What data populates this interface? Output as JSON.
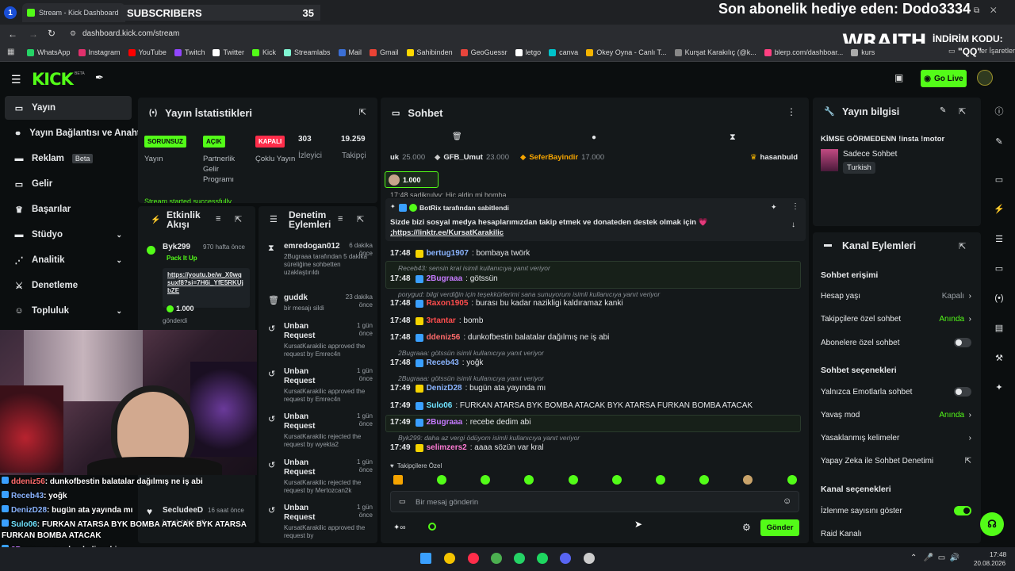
{
  "browser": {
    "tab_title": "Stream - Kick Dashboard",
    "url": "dashboard.kick.com/stream",
    "bookmarks": [
      "WhatsApp",
      "Instagram",
      "YouTube",
      "Twitch",
      "Twitter",
      "Kick",
      "Streamlabs",
      "Mail",
      "Gmail",
      "Sahibinden",
      "GeoGuessr",
      "letgo",
      "canva",
      "Okey Oyna - Canlı T...",
      "Kurşat Karakılıç (@k...",
      "blerp.com/dashboar...",
      "kurs"
    ],
    "other_bookmarks": "ler İşaretleri"
  },
  "overlay": {
    "subscribers_label": "SUBSCRIBERS",
    "subscribers_count": "35",
    "gift_text": "Son abonelik hediye eden: Dodo3334",
    "sponsor": "WRAITH.",
    "discount_label": "İNDİRİM KODU:",
    "discount_code": "\"QQ\"",
    "chat": [
      {
        "user": "ddeniz56",
        "text": ": dunkofbestin balatalar dağılmış ne iş abi",
        "color": "#ff6b6b"
      },
      {
        "user": "Receb43",
        "text": ": yoğk",
        "color": "#8ab4ff"
      },
      {
        "user": "DenizD28",
        "text": ": bugün ata yayında mı",
        "color": "#8ab4ff"
      },
      {
        "user": "Sulo06",
        "text": ": FURKAN ATARSA BYK BOMBA ATACAK BYK ATARSA",
        "color": "#6fe3ff"
      },
      {
        "user": "",
        "text": "FURKAN BOMBA ATACAK",
        "color": "#ffffff"
      },
      {
        "user": "2Bugraaa",
        "text": ": recebe dedim abi",
        "color": "#c67bff"
      },
      {
        "user": "selimzers2",
        "text": ": aaaa sözün var kral",
        "color": "#ff7bd5"
      }
    ]
  },
  "kick": {
    "logo": "KICK",
    "beta": "BETA",
    "go_live": "Go Live"
  },
  "sidebar": {
    "items": [
      {
        "label": "Yayın",
        "icon": "video-icon"
      },
      {
        "label": "Yayın Bağlantısı ve Anahtar",
        "icon": "link-icon"
      },
      {
        "label": "Reklam",
        "icon": "ad-icon",
        "badge": "Beta"
      },
      {
        "label": "Gelir",
        "icon": "wallet-icon"
      },
      {
        "label": "Başarılar",
        "icon": "trophy-icon"
      },
      {
        "label": "Stüdyo",
        "icon": "studio-icon"
      },
      {
        "label": "Analitik",
        "icon": "chart-icon"
      },
      {
        "label": "Denetleme",
        "icon": "sword-icon"
      },
      {
        "label": "Topluluk",
        "icon": "community-icon"
      }
    ]
  },
  "stats": {
    "title": "Yayın İstatistikleri",
    "tags": [
      {
        "tag": "SORUNSUZ",
        "label": "Yayın",
        "bg": "#53fc18"
      },
      {
        "tag": "AÇIK",
        "label": "Partnerlik Gelir Programı",
        "bg": "#53fc18"
      },
      {
        "tag": "KAPALI",
        "label": "Çoklu Yayın",
        "bg": "#ff2d4a"
      }
    ],
    "viewers": "303",
    "viewers_label": "İzleyici",
    "followers": "19.259",
    "followers_label": "Takipçi",
    "banner": "Stream started successfully"
  },
  "activity": {
    "title": "Etkinlik Akışı",
    "user": "Byk299",
    "time": "970 hafta önce",
    "event": "Pack It Up",
    "link": "https://youtu.be/w_X0wqsuxf8?si=7H6i_YfE5RKUjbZE",
    "amount": "1.000",
    "sent": "gönderdi",
    "follow_user": "SecludeeD",
    "follow_time": "16 saat önce",
    "follow_text": "kanalı takip etti"
  },
  "modlog": {
    "title": "Denetim Eylemleri",
    "items": [
      {
        "user": "emredogan012",
        "time": "6 dakika önce",
        "desc": "2Bugraaa tarafından 5 dakika süreliğine sohbetten uzaklaştırıldı"
      },
      {
        "user": "guddk",
        "time": "23 dakika önce",
        "desc": "bir mesajı sildi"
      },
      {
        "user": "Unban Request",
        "time": "1 gün önce",
        "desc": "KursatKarakilic approved the request by Emrec4n"
      },
      {
        "user": "Unban Request",
        "time": "1 gün önce",
        "desc": "KursatKarakilic approved the request by Emrec4n"
      },
      {
        "user": "Unban Request",
        "time": "1 gün önce",
        "desc": "KursatKarakilic rejected the request by wyekta2"
      },
      {
        "user": "Unban Request",
        "time": "1 gün önce",
        "desc": "KursatKarakilic rejected the request by Mertozcan2k"
      },
      {
        "user": "Unban Request",
        "time": "1 gün önce",
        "desc": "KursatKarakilic approved the request by"
      }
    ]
  },
  "chat": {
    "title": "Sohbet",
    "leaderboard": [
      {
        "name": "uk",
        "amount": "25.000"
      },
      {
        "name": "GFB_Umut",
        "amount": "23.000"
      },
      {
        "name": "SeferBayindir",
        "amount": "17.000"
      },
      {
        "name": "hasanbuld",
        "amount": ""
      }
    ],
    "gift_amount": "1.000",
    "pinned_by": "BotRix tarafından sabitlendi",
    "pinned_text": "Sizde bizi sosyal medya hesaplarımızdan takip etmek ve donateden destek olmak için 💗",
    "pinned_link": ";https://linktr.ee/KursatKarakilic",
    "cut_line": "17:48  sadikrulyv: Hic aldin mi bomba",
    "messages": [
      {
        "time": "17:48",
        "user": "bertug1907",
        "color": "#8ab4ff",
        "text": ": bombaya twörk",
        "reply": ""
      },
      {
        "time": "17:48",
        "user": "2Bugraaa",
        "color": "#c67bff",
        "text": ": götssün",
        "reply": "Receb43: sensin kral isimli kullanıcıya yanıt veriyor"
      },
      {
        "time": "17:48",
        "user": "Raxon1905",
        "color": "#ff4d4d",
        "text": ": burası bu kadar nazikligi kaldıramaz kanki",
        "reply": "porygud: bilgi verdiğin için teşekkürlerimi sana sunuyorum isimli kullanıcıya yanıt veriyor"
      },
      {
        "time": "17:48",
        "user": "3rtantar",
        "color": "#ff4d4d",
        "text": ": bomb",
        "reply": ""
      },
      {
        "time": "17:48",
        "user": "ddeniz56",
        "color": "#ff6b6b",
        "text": ": dunkofbestin balatalar dağılmış ne iş abi",
        "reply": ""
      },
      {
        "time": "17:48",
        "user": "Receb43",
        "color": "#8ab4ff",
        "text": ": yoğk",
        "reply": "2Bugraaa: götssün isimli kullanıcıya yanıt veriyor"
      },
      {
        "time": "17:49",
        "user": "DenizD28",
        "color": "#8ab4ff",
        "text": ": bugün ata yayında mı",
        "reply": "2Bugraaa: götssün isimli kullanıcıya yanıt veriyor"
      },
      {
        "time": "17:49",
        "user": "Sulo06",
        "color": "#6fe3ff",
        "text": ": FURKAN ATARSA BYK BOMBA ATACAK BYK ATARSA FURKAN BOMBA ATACAK",
        "reply": ""
      },
      {
        "time": "17:49",
        "user": "2Bugraaa",
        "color": "#c67bff",
        "text": ": recebe dedim abi",
        "reply": ""
      },
      {
        "time": "17:49",
        "user": "selimzers2",
        "color": "#ff7bd5",
        "text": ": aaaa sözün var kral",
        "reply": "Byk299: daha az vergi ödüyom isimli kullanıcıya yanıt veriyor"
      }
    ],
    "followers_only": "Takipçilere Özel",
    "input_placeholder": "Bir mesaj gönderin",
    "send_label": "Gönder"
  },
  "info": {
    "title": "Yayın bilgisi",
    "stream_title": "KİMSE GÖRMEDENN !insta !motor",
    "category": "Sadece Sohbet",
    "language": "Turkish"
  },
  "actions": {
    "title": "Kanal Eylemleri",
    "chat_access": "Sohbet erişimi",
    "account_age": "Hesap yaşı",
    "account_age_val": "Kapalı",
    "followers_chat": "Takipçilere özel sohbet",
    "followers_chat_val": "Anında",
    "subs_chat": "Abonelere özel sohbet",
    "chat_options": "Sohbet seçenekleri",
    "emote_only": "Yalnızca Emotlarla sohbet",
    "slow_mode": "Yavaş mod",
    "slow_mode_val": "Anında",
    "banned_words": "Yasaklanmış kelimeler",
    "ai_mod": "Yapay Zeka ile Sohbet Denetimi",
    "channel_options": "Kanal seçenekleri",
    "show_viewers": "İzlenme sayısını göster",
    "raid": "Raid Kanalı"
  },
  "taskbar": {
    "time": "17:48",
    "date": "20.08.2026"
  }
}
